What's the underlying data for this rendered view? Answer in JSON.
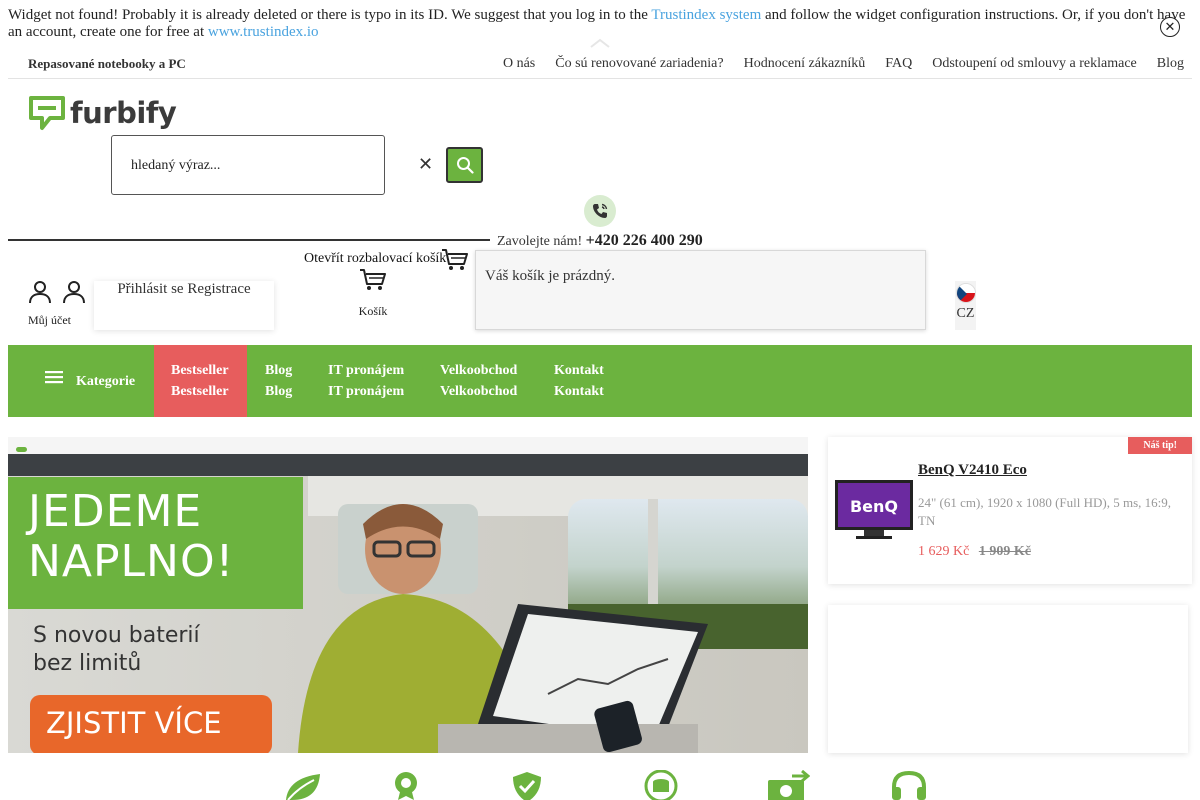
{
  "notice": {
    "before": "Widget not found! Probably it is already deleted or there is typo in its ID. We suggest that you log in to the ",
    "link1": "Trustindex system",
    "middle": " and follow the widget configuration instructions. Or, if you don't have an account, create one for free at ",
    "link2": "www.trustindex.io"
  },
  "topbar": {
    "tagline": "Repasované notebooky a PC",
    "links": [
      "O nás",
      "Čo sú renovované zariadenia?",
      "Hodnocení zákazníků",
      "FAQ",
      "Odstoupení od smlouvy a reklamace",
      "Blog"
    ]
  },
  "logo": {
    "text": "furbify"
  },
  "search": {
    "placeholder": "hledaný výraz..."
  },
  "contact": {
    "label": "Zavolejte nám!",
    "phone": "+420 226 400 290"
  },
  "cart": {
    "open_label": "Otevřít rozbalovací košík",
    "label": "Košík",
    "empty_text": "Váš košík je prázdný."
  },
  "account": {
    "label": "Můj účet",
    "login": "Přihlásit se",
    "register": "Registrace"
  },
  "language": {
    "code": "CZ"
  },
  "mainnav": {
    "categories": "Kategorie",
    "items": [
      {
        "l1": "Bestseller",
        "l2": "Bestseller"
      },
      {
        "l1": "Blog",
        "l2": "Blog"
      },
      {
        "l1": "IT pronájem",
        "l2": "IT pronájem"
      },
      {
        "l1": "Velkoobchod",
        "l2": "Velkoobchod"
      },
      {
        "l1": "Kontakt",
        "l2": "Kontakt"
      }
    ]
  },
  "hero": {
    "title_line1": "JEDEME",
    "title_line2": "NAPLNO!",
    "sub_line1": "S novou baterií",
    "sub_line2": "bez limitů",
    "cta": "ZJISTIT VÍCE"
  },
  "tip": {
    "badge": "Náš tip!",
    "name": "BenQ V2410 Eco",
    "description": "24\" (61 cm), 1920 x 1080 (Full HD), 5 ms, 16:9, TN",
    "price": "1 629 Kč",
    "old_price": "1 909 Kč"
  },
  "colors": {
    "brand_green": "#6cb33f",
    "accent_red": "#e75d5d",
    "cta_orange": "#e8672a",
    "link_blue": "#4aa3df"
  },
  "features_icons": [
    "leaf-icon",
    "award-icon",
    "shield-check-icon",
    "coins-icon",
    "money-transfer-icon",
    "headset-icon"
  ]
}
